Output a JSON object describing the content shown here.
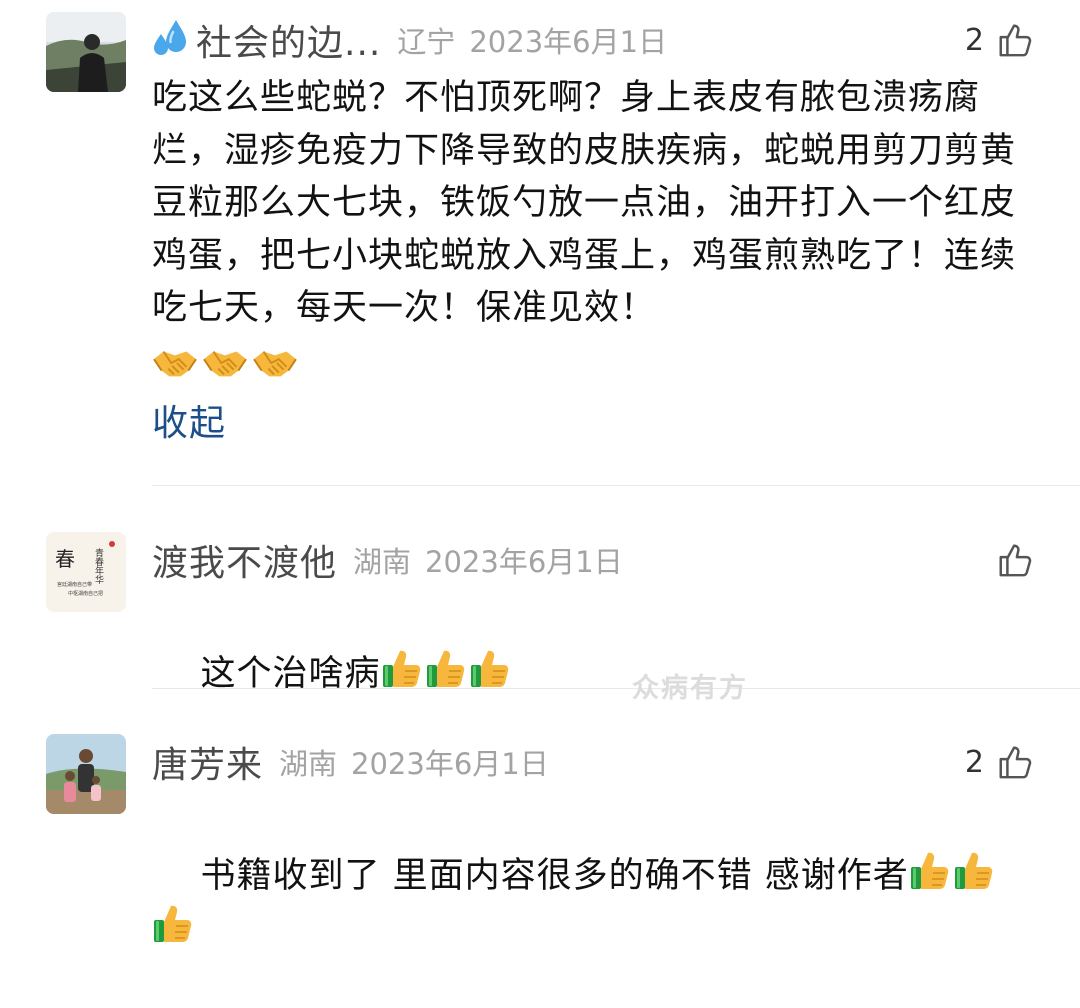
{
  "comments": [
    {
      "username": "社会的边...",
      "location": "辽宁",
      "date": "2023年6月1日",
      "likes": "2",
      "text": "吃这么些蛇蜕？不怕顶死啊？身上表皮有脓包溃疡腐烂，湿疹免疫力下降导致的皮肤疾病，蛇蜕用剪刀剪黄豆粒那么大七块，铁饭勺放一点油，油开打入一个红皮鸡蛋，把七小块蛇蜕放入鸡蛋上，鸡蛋煎熟吃了！连续吃七天，每天一次！保准见效！",
      "collapse_label": "收起"
    },
    {
      "username": "渡我不渡他",
      "location": "湖南",
      "date": "2023年6月1日",
      "likes": "",
      "text": "这个治啥病"
    },
    {
      "username": "唐芳来",
      "location": "湖南",
      "date": "2023年6月1日",
      "likes": "2",
      "text": "书籍收到了 里面内容很多的确不错 感谢作者"
    }
  ],
  "watermark": "众病有方",
  "avatar2_text": {
    "main": "春",
    "side": "青春年华",
    "line1": "宫廷湖南自己带",
    "line2": "中枢湖南自己把"
  },
  "icons": {
    "like": "thumbs-up-outline-icon",
    "handshake": "handshake-emoji-icon",
    "thumbs": "thumbs-up-emoji-icon",
    "drop": "sweat-droplets-icon"
  },
  "colors": {
    "link": "#1c4f8a",
    "meta": "#a3a3a3",
    "name": "#4a4a4a"
  }
}
